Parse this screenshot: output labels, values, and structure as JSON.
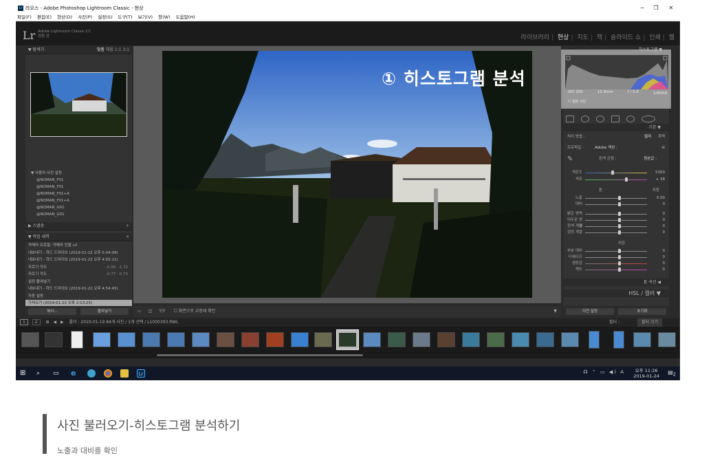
{
  "window": {
    "title": "라오스 - Adobe Photoshop Lightroom Classic - 현상",
    "controls": [
      "−",
      "❐",
      "✕"
    ]
  },
  "menu": [
    "파일(F)",
    "편집(E)",
    "현상(D)",
    "사진(P)",
    "설정(S)",
    "도구(T)",
    "보기(V)",
    "창(W)",
    "도움말(H)"
  ],
  "identity": {
    "logo": "Lr",
    "product": "Adobe Lightroom Classic CC",
    "user": "정원 강"
  },
  "modules": [
    {
      "label": "라이브러리",
      "active": false
    },
    {
      "label": "현상",
      "active": true
    },
    {
      "label": "지도",
      "active": false
    },
    {
      "label": "책",
      "active": false
    },
    {
      "label": "슬라이드 쇼",
      "active": false
    },
    {
      "label": "인쇄",
      "active": false
    },
    {
      "label": "웹",
      "active": false
    }
  ],
  "left_panel": {
    "navigator": {
      "title": "탐색기",
      "zoom": [
        "맞춤",
        "채움",
        "1:1",
        "3:1"
      ]
    },
    "presets": {
      "group": "사용자 사전 설정",
      "items": [
        "@NOMAN_F01",
        "@NOMAN_F01",
        "@NOMAN_F01+A",
        "@NOMAN_F01+A",
        "@NOMAN_G01",
        "@NOMAN_G01"
      ]
    },
    "snapshots": {
      "title": "스냅숏"
    },
    "history": {
      "title": "작업 내역",
      "items": [
        {
          "label": "카메라 프로필: 카메라 인물 v2",
          "v1": "",
          "v2": ""
        },
        {
          "label": "내보내기 - 하드 드라이브 (2019-01-22 오후 5:04:09)",
          "v1": "",
          "v2": ""
        },
        {
          "label": "내보내기 - 하드 드라이브 (2019-01-22 오후 4:55:11)",
          "v1": "",
          "v2": ""
        },
        {
          "label": "자르기 각도",
          "v1": "-0.96",
          "v2": "-1.72"
        },
        {
          "label": "자르기 각도",
          "v1": "-0.77",
          "v2": "-0.73"
        },
        {
          "label": "설정 붙여넣기",
          "v1": "",
          "v2": ""
        },
        {
          "label": "내보내기 - 하드 드라이브 (2019-01-22 오후 4:54:45)",
          "v1": "",
          "v2": ""
        },
        {
          "label": "자동 설정",
          "v1": "",
          "v2": ""
        },
        {
          "label": "가져오기 (2019-01-22 오후 2:13:23)",
          "v1": "",
          "v2": "",
          "selected": true
        }
      ]
    },
    "buttons": {
      "copy": "복사...",
      "paste": "붙여넣기"
    }
  },
  "toolbar": {
    "soft_proof": "화면으로 교정쇄 확인"
  },
  "overlay_text": "① 히스토그램 분석",
  "right_panel": {
    "histogram": {
      "title": "히스토그램",
      "iso": "ISO 200",
      "focal": "15.9mm",
      "aperture": "f / 5.6",
      "shutter": "1/400초",
      "original": "원본 사진"
    },
    "basic": {
      "title": "기본",
      "treatment_label": "처리 방법 :",
      "color": "컬러",
      "bw": "흑백",
      "profile_label": "프로파일 :",
      "profile": "Adobe 색상 :",
      "wb_label": "흰색 균형 :",
      "wb": "원본값 :",
      "temp": {
        "label": "색온도",
        "value": "5300"
      },
      "tint": {
        "label": "색조",
        "value": "+ 38"
      },
      "tone": "톤",
      "auto": "자동",
      "exposure": {
        "label": "노출",
        "value": "0.00"
      },
      "contrast": {
        "label": "대비",
        "value": "0"
      },
      "highlights": {
        "label": "밝은 영역",
        "value": "0"
      },
      "shadows": {
        "label": "어두운 영역",
        "value": "0"
      },
      "whites": {
        "label": "흰색 계열",
        "value": "0"
      },
      "blacks": {
        "label": "검정 계열",
        "value": "0"
      },
      "presence": "외관",
      "texture": {
        "label": "부분 대비",
        "value": "0"
      },
      "clarity": {
        "label": "디헤이즈",
        "value": "0"
      },
      "vibrance": {
        "label": "생동감",
        "value": "0"
      },
      "saturation": {
        "label": "채도",
        "value": "0"
      }
    },
    "tone_curve": "톤 곡선",
    "hsl": "HSL / 컬러",
    "buttons": {
      "previous": "이전 설정",
      "reset": "초기화"
    }
  },
  "filmstrip": {
    "info": "폴더 : 2019-01-19   84개 사진 / 1개 선택 / L1000393.RWL",
    "filter_label": "필터 :",
    "filter_value": "필터 끄기"
  },
  "taskbar": {
    "clock_time": "오후 11:26",
    "clock_date": "2019-01-24",
    "ime": "A",
    "notif": "2"
  },
  "caption": {
    "title": "사진 불러오기-히스토그램 분석하기",
    "subtitle": "노출과 대비를 확인"
  },
  "colors": {
    "accent": "#ffffff",
    "panel": "#333333",
    "bg": "#2a2a2a"
  }
}
